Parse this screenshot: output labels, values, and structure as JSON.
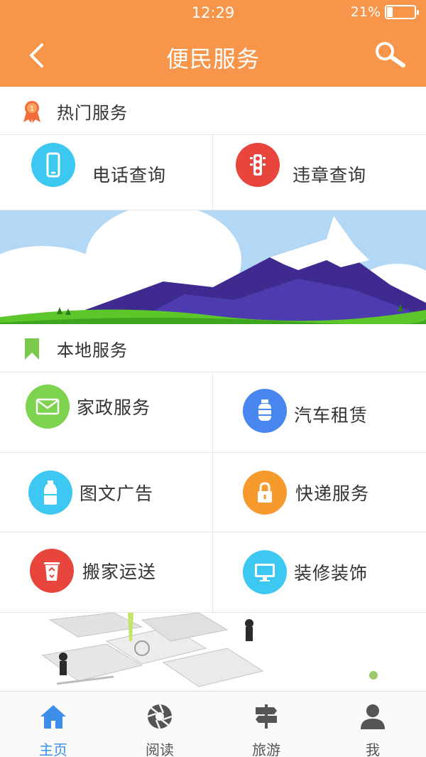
{
  "status_bar": {
    "time": "12:29",
    "battery": "21%",
    "battery_level": 0.21
  },
  "nav": {
    "title": "便民服务",
    "back_icon": "chevron-left-icon",
    "search_icon": "search-icon"
  },
  "hot_section": {
    "title": "热门服务",
    "icon": "award-ribbon-icon",
    "items": [
      {
        "label": "电话查询",
        "icon": "phone-icon",
        "color": "#3cc8f0"
      },
      {
        "label": "违章查询",
        "icon": "traffic-light-icon",
        "color": "#e8453c"
      }
    ]
  },
  "local_section": {
    "title": "本地服务",
    "icon": "bookmark-icon",
    "items": [
      {
        "label": "家政服务",
        "icon": "envelope-icon",
        "color": "#7dd24e"
      },
      {
        "label": "汽车租赁",
        "icon": "gas-tank-icon",
        "color": "#4a86f0"
      },
      {
        "label": "图文广告",
        "icon": "water-bottle-icon",
        "color": "#3cc8f0"
      },
      {
        "label": "快递服务",
        "icon": "lock-icon",
        "color": "#f79a2e"
      },
      {
        "label": "搬家运送",
        "icon": "recycle-bin-icon",
        "color": "#e8453c"
      },
      {
        "label": "装修装饰",
        "icon": "monitor-icon",
        "color": "#3cc8f0"
      }
    ]
  },
  "tabbar": {
    "items": [
      {
        "label": "主页",
        "icon": "home-icon",
        "active": true
      },
      {
        "label": "阅读",
        "icon": "aperture-icon",
        "active": false
      },
      {
        "label": "旅游",
        "icon": "signpost-icon",
        "active": false
      },
      {
        "label": "我",
        "icon": "user-icon",
        "active": false
      }
    ],
    "active_color": "#3b8fe8",
    "inactive_color": "#555555"
  },
  "colors": {
    "header": "#f7964a",
    "divider": "#e6e6e6"
  }
}
